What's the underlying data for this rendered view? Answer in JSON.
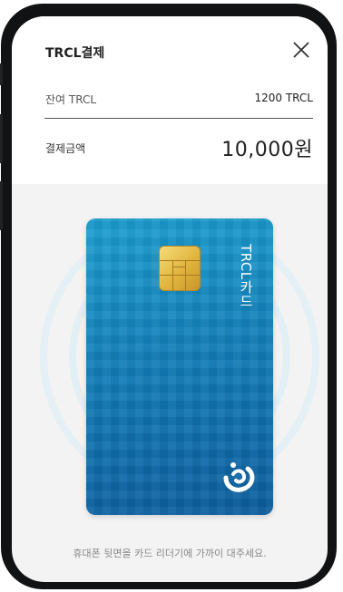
{
  "header": {
    "title": "TRCL결제",
    "close_icon": "close-icon"
  },
  "balance": {
    "label": "잔여 TRCL",
    "value": "1200 TRCL"
  },
  "payment": {
    "label": "결제금액",
    "value": "10,000원"
  },
  "card": {
    "name": "TRCL카드",
    "chip_icon": "chip-icon",
    "logo_icon": "brand-logo-icon"
  },
  "hint": "휴대폰 뒷면을 카드 리더기에 가까이 대주세요.",
  "colors": {
    "card": "#137fba",
    "background": "#f3f3f3",
    "frame": "#111214"
  }
}
